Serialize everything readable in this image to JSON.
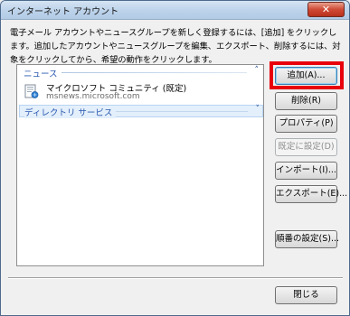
{
  "window": {
    "title": "インターネット アカウント",
    "close_glyph": "✕"
  },
  "intro_text": "電子メール アカウントやニュースグループを新しく登録するには、[追加] をクリックします。追加したアカウントやニュースグループを編集、エクスポート、削除するには、対象をクリックしてから、希望の動作をクリックします。",
  "list": {
    "groups": [
      {
        "label": "ニュース",
        "chevron": "˄"
      },
      {
        "label": "ディレクトリ サービス",
        "chevron": "˅"
      }
    ],
    "accounts": [
      {
        "name": "マイクロソフト コミュニティ (既定)",
        "server": "msnews.microsoft.com",
        "icon": "news-account-icon"
      }
    ]
  },
  "buttons": {
    "add": "追加(A)...",
    "remove": "削除(R)",
    "properties": "プロパティ(P)",
    "set_default": "既定に設定(D)",
    "import": "インポート(I)...",
    "export": "エクスポート(E)...",
    "set_order": "順番の設定(S)...",
    "close": "閉じる"
  },
  "colors": {
    "highlight": "#e8000b",
    "group_header_text": "#2b5ab0"
  }
}
